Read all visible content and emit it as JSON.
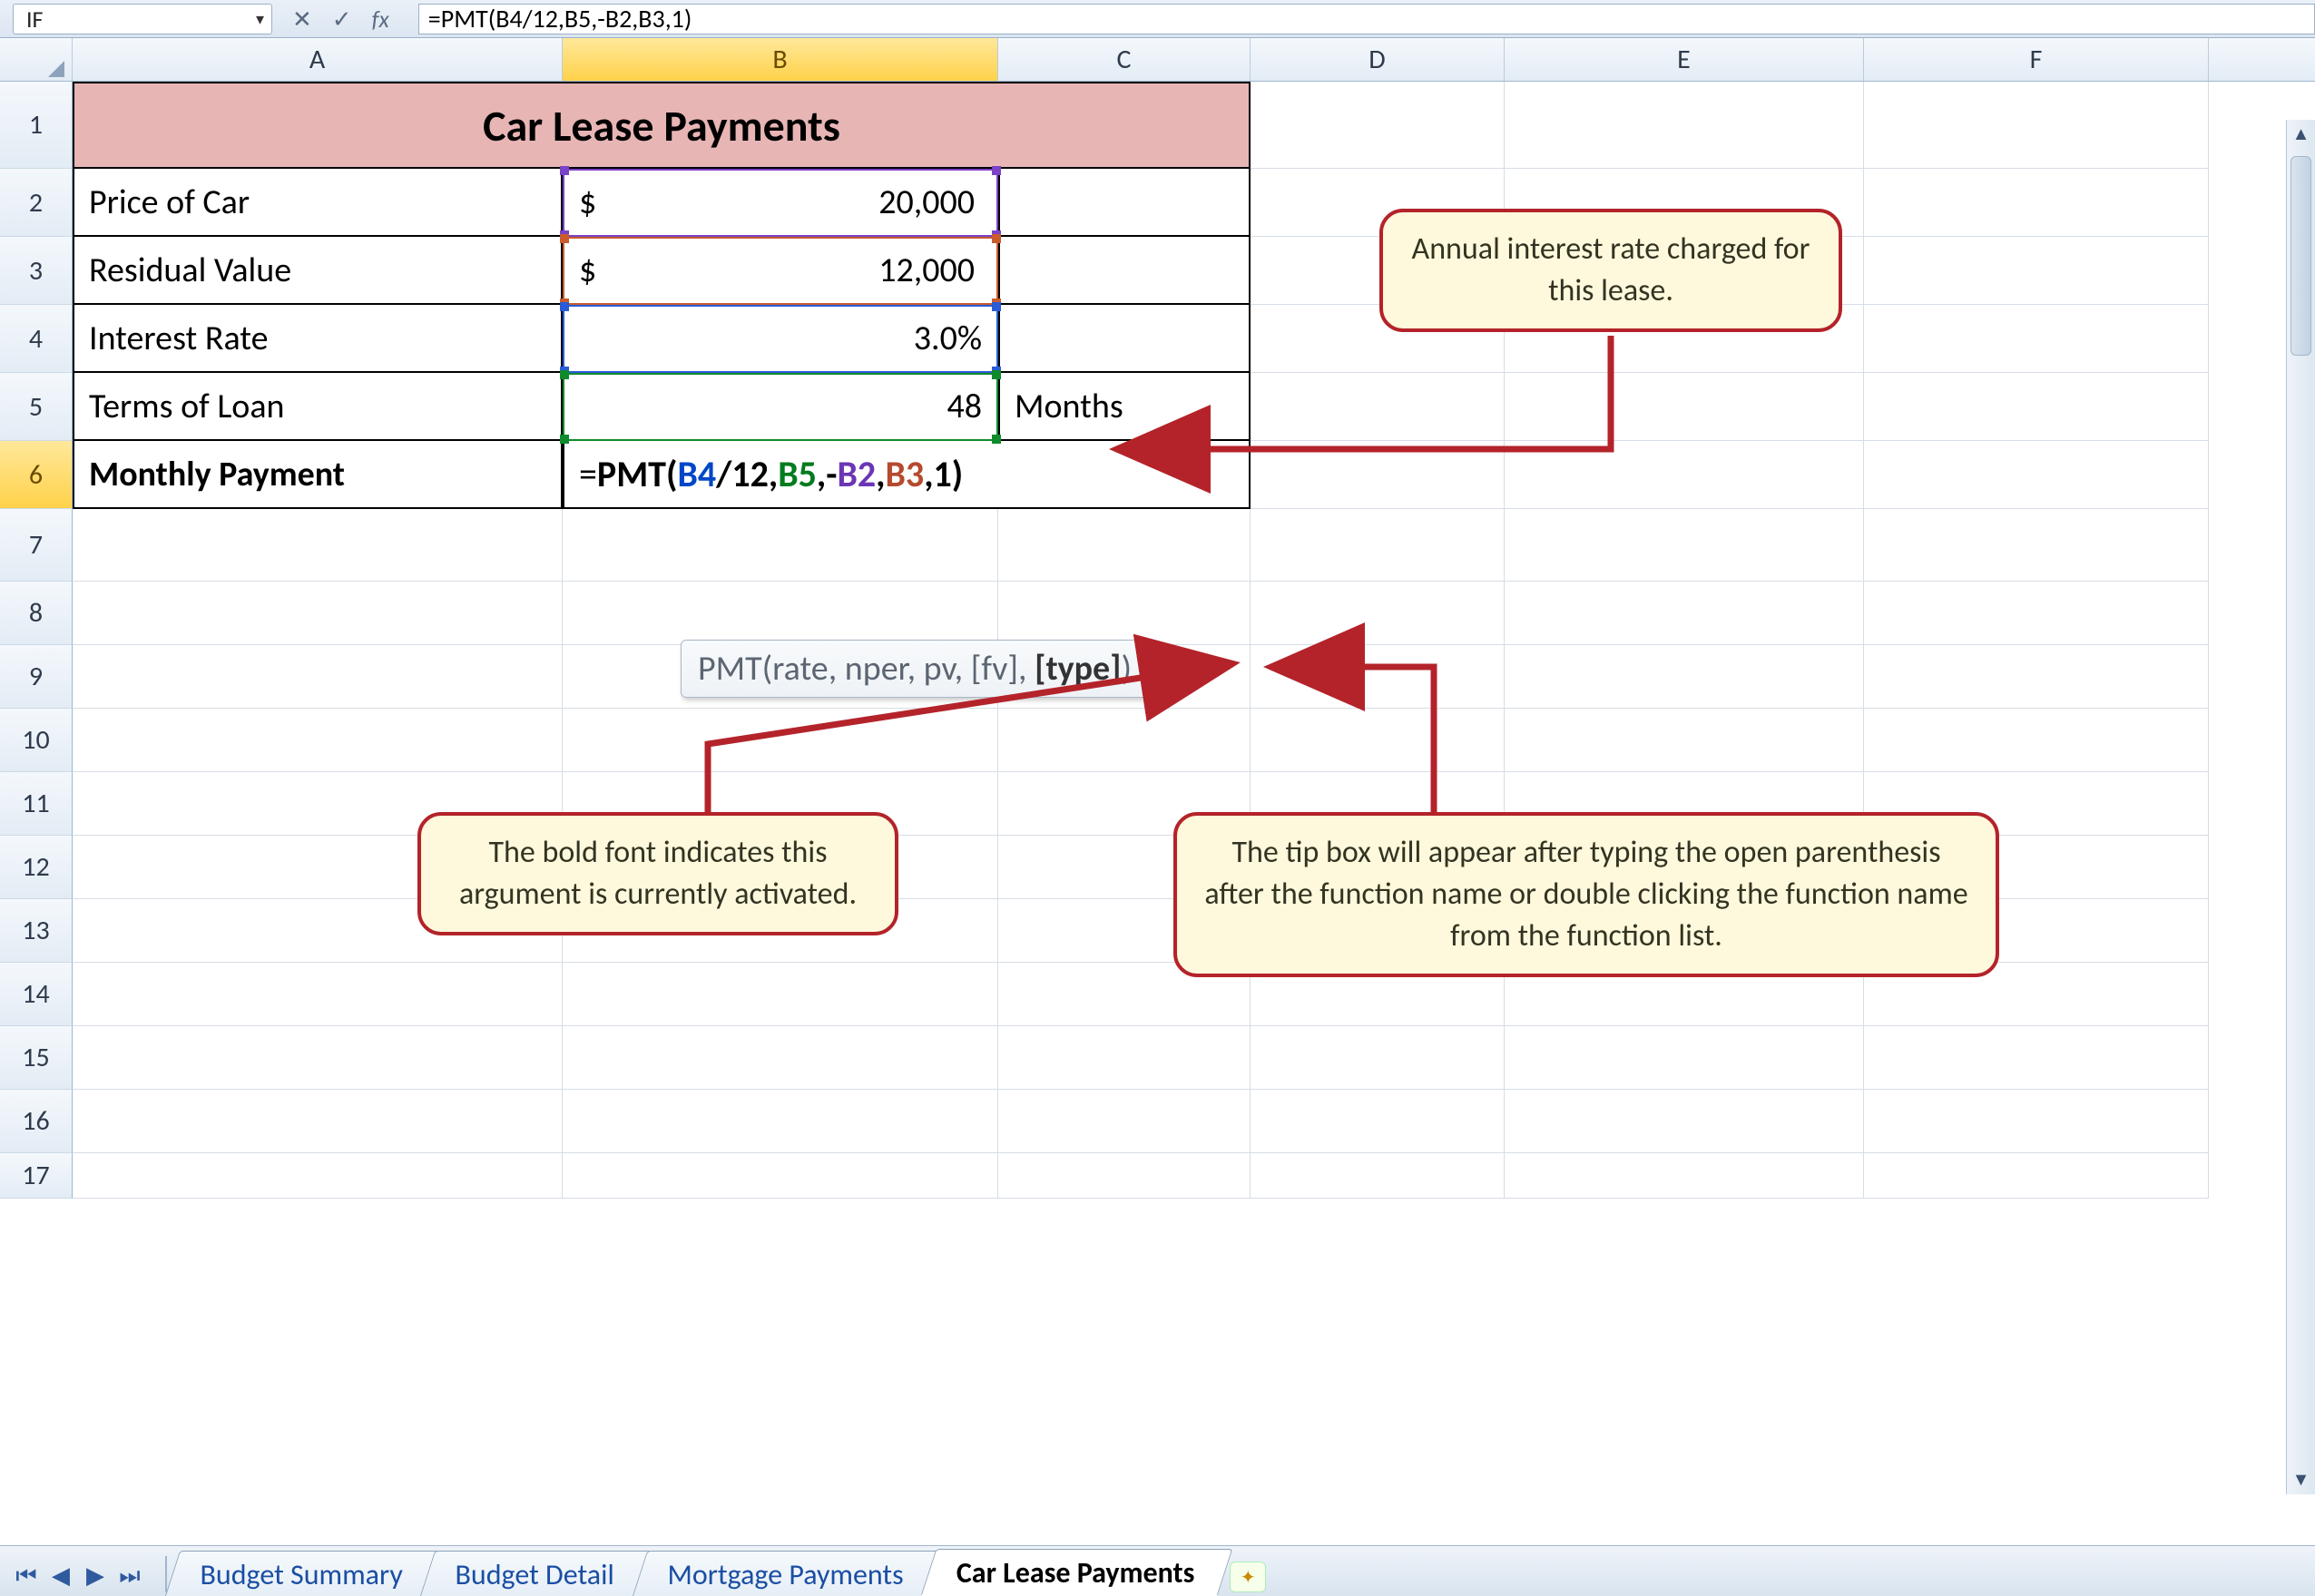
{
  "name_box": {
    "value": "IF"
  },
  "formula_bar": {
    "text": "=PMT(B4/12,B5,-B2,B3,1)"
  },
  "columns": [
    "A",
    "B",
    "C",
    "D",
    "E",
    "F"
  ],
  "rows": [
    1,
    2,
    3,
    4,
    5,
    6,
    7,
    8,
    9,
    10,
    11,
    12,
    13,
    14,
    15,
    16,
    17
  ],
  "active_cell": "B6",
  "title": "Car Lease Payments",
  "data_rows": {
    "r2": {
      "label": "Price of Car",
      "sym": "$",
      "value": "20,000",
      "note": ""
    },
    "r3": {
      "label": "Residual Value",
      "sym": "$",
      "value": "12,000",
      "note": ""
    },
    "r4": {
      "label": "Interest Rate",
      "sym": "",
      "value": "3.0%",
      "note": ""
    },
    "r5": {
      "label": "Terms of Loan",
      "sym": "",
      "value": "48",
      "note": "Months"
    },
    "r6": {
      "label": "Monthly Payment"
    }
  },
  "formula_parts": {
    "prefix": "=",
    "fn": "PMT",
    "open": "(",
    "b4": "B4",
    "div": "/12,",
    "b5": "B5",
    "c1": ",-",
    "b2": "B2",
    "c2": ",",
    "b3": "B3",
    "c3": ",1)"
  },
  "tooltip": {
    "fn": "PMT",
    "sig_before": "(rate, nper, pv, [fv], ",
    "sig_bold": "[type]",
    "sig_after": ")"
  },
  "callouts": {
    "interest_rate": "Annual interest rate charged for this lease.",
    "tip_box": "The tip box will appear after typing the open parenthesis after the function name or double clicking the function name from the function list.",
    "bold_arg": "The bold font indicates this argument is currently activated."
  },
  "tabs": {
    "items": [
      "Budget Summary",
      "Budget Detail",
      "Mortgage Payments",
      "Car Lease Payments"
    ],
    "active": "Car Lease Payments"
  },
  "chart_data": {
    "type": "table",
    "title": "Car Lease Payments",
    "rows": [
      {
        "label": "Price of Car",
        "value": 20000,
        "unit": "$"
      },
      {
        "label": "Residual Value",
        "value": 12000,
        "unit": "$"
      },
      {
        "label": "Interest Rate",
        "value": 0.03,
        "unit": "%"
      },
      {
        "label": "Terms of Loan",
        "value": 48,
        "unit": "Months"
      },
      {
        "label": "Monthly Payment",
        "value": "=PMT(B4/12,B5,-B2,B3,1)",
        "unit": "formula"
      }
    ]
  }
}
